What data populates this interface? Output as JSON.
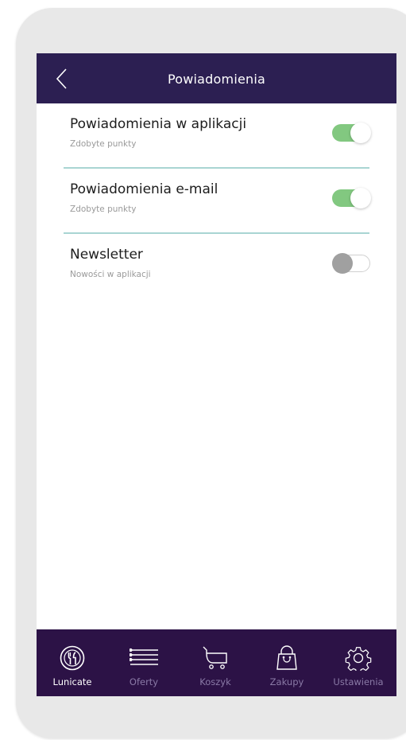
{
  "header": {
    "title": "Powiadomienia",
    "back_icon": "chevron-left-icon"
  },
  "settings": [
    {
      "title": "Powiadomienia w aplikacji",
      "subtitle": "Zdobyte punkty",
      "enabled": true
    },
    {
      "title": "Powiadomienia e-mail",
      "subtitle": "Zdobyte punkty",
      "enabled": true
    },
    {
      "title": "Newsletter",
      "subtitle": "Nowości w aplikacji",
      "enabled": false
    }
  ],
  "tabbar": {
    "items": [
      {
        "label": "Lunicate",
        "icon": "plate-fork-knife-icon",
        "active": true
      },
      {
        "label": "Oferty",
        "icon": "list-icon",
        "active": false
      },
      {
        "label": "Koszyk",
        "icon": "cart-icon",
        "active": false
      },
      {
        "label": "Zakupy",
        "icon": "shopping-bag-icon",
        "active": false
      },
      {
        "label": "Ustawienia",
        "icon": "gear-icon",
        "active": false
      }
    ]
  },
  "colors": {
    "header_bg": "#2c1f52",
    "tabbar_bg": "#2c1246",
    "toggle_on": "#82c880",
    "toggle_off_knob": "#a0a0a0",
    "divider": "#a9d5d3",
    "tab_inactive": "#8a7aa6",
    "tab_active": "#ffffff"
  }
}
